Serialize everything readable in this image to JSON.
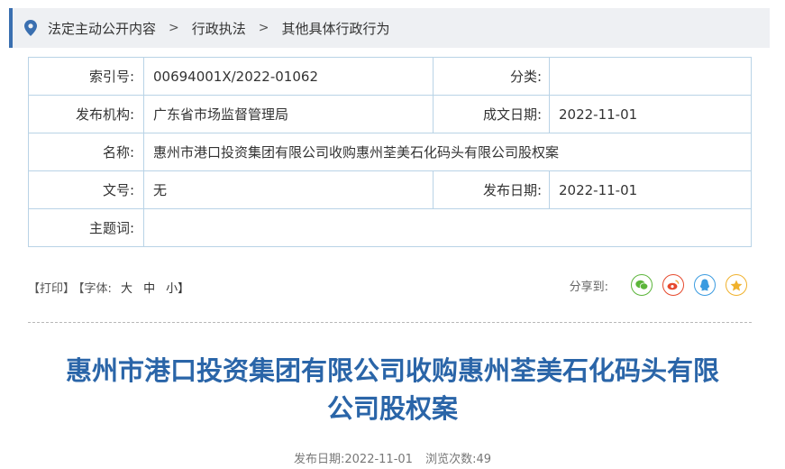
{
  "breadcrumb": {
    "items": [
      "法定主动公开内容",
      "行政执法",
      "其他具体行政行为"
    ],
    "separator": ">"
  },
  "meta": {
    "index_label": "索引号:",
    "index_value": "00694001X/2022-01062",
    "category_label": "分类:",
    "category_value": "",
    "publisher_label": "发布机构:",
    "publisher_value": "广东省市场监督管理局",
    "written_date_label": "成文日期:",
    "written_date_value": "2022-11-01",
    "name_label": "名称:",
    "name_value": "惠州市港口投资集团有限公司收购惠州荃美石化码头有限公司股权案",
    "doc_no_label": "文号:",
    "doc_no_value": "无",
    "publish_date_label": "发布日期:",
    "publish_date_value": "2022-11-01",
    "subject_label": "主题词:",
    "subject_value": ""
  },
  "tools": {
    "print": "【打印】",
    "font_open": "【字体:",
    "font_large": "大",
    "font_medium": "中",
    "font_small": "小】"
  },
  "share": {
    "label": "分享到:",
    "icons": [
      "wechat-icon",
      "weibo-icon",
      "qq-icon",
      "qzone-icon"
    ],
    "colors": {
      "wechat": "#5bb53a",
      "weibo": "#e6492d",
      "qq": "#3a9be0",
      "qzone": "#f0b12c"
    }
  },
  "article": {
    "title_line1": "惠州市港口投资集团有限公司收购惠州荃美石化码头有限",
    "title_line2": "公司股权案",
    "publish_date_label": "发布日期:",
    "publish_date": "2022-11-01",
    "views_label": "浏览次数:",
    "views": "49"
  },
  "colors": {
    "accent": "#2a65a8",
    "border": "#b9d3e6",
    "crumb_bg": "#eef0f3"
  }
}
